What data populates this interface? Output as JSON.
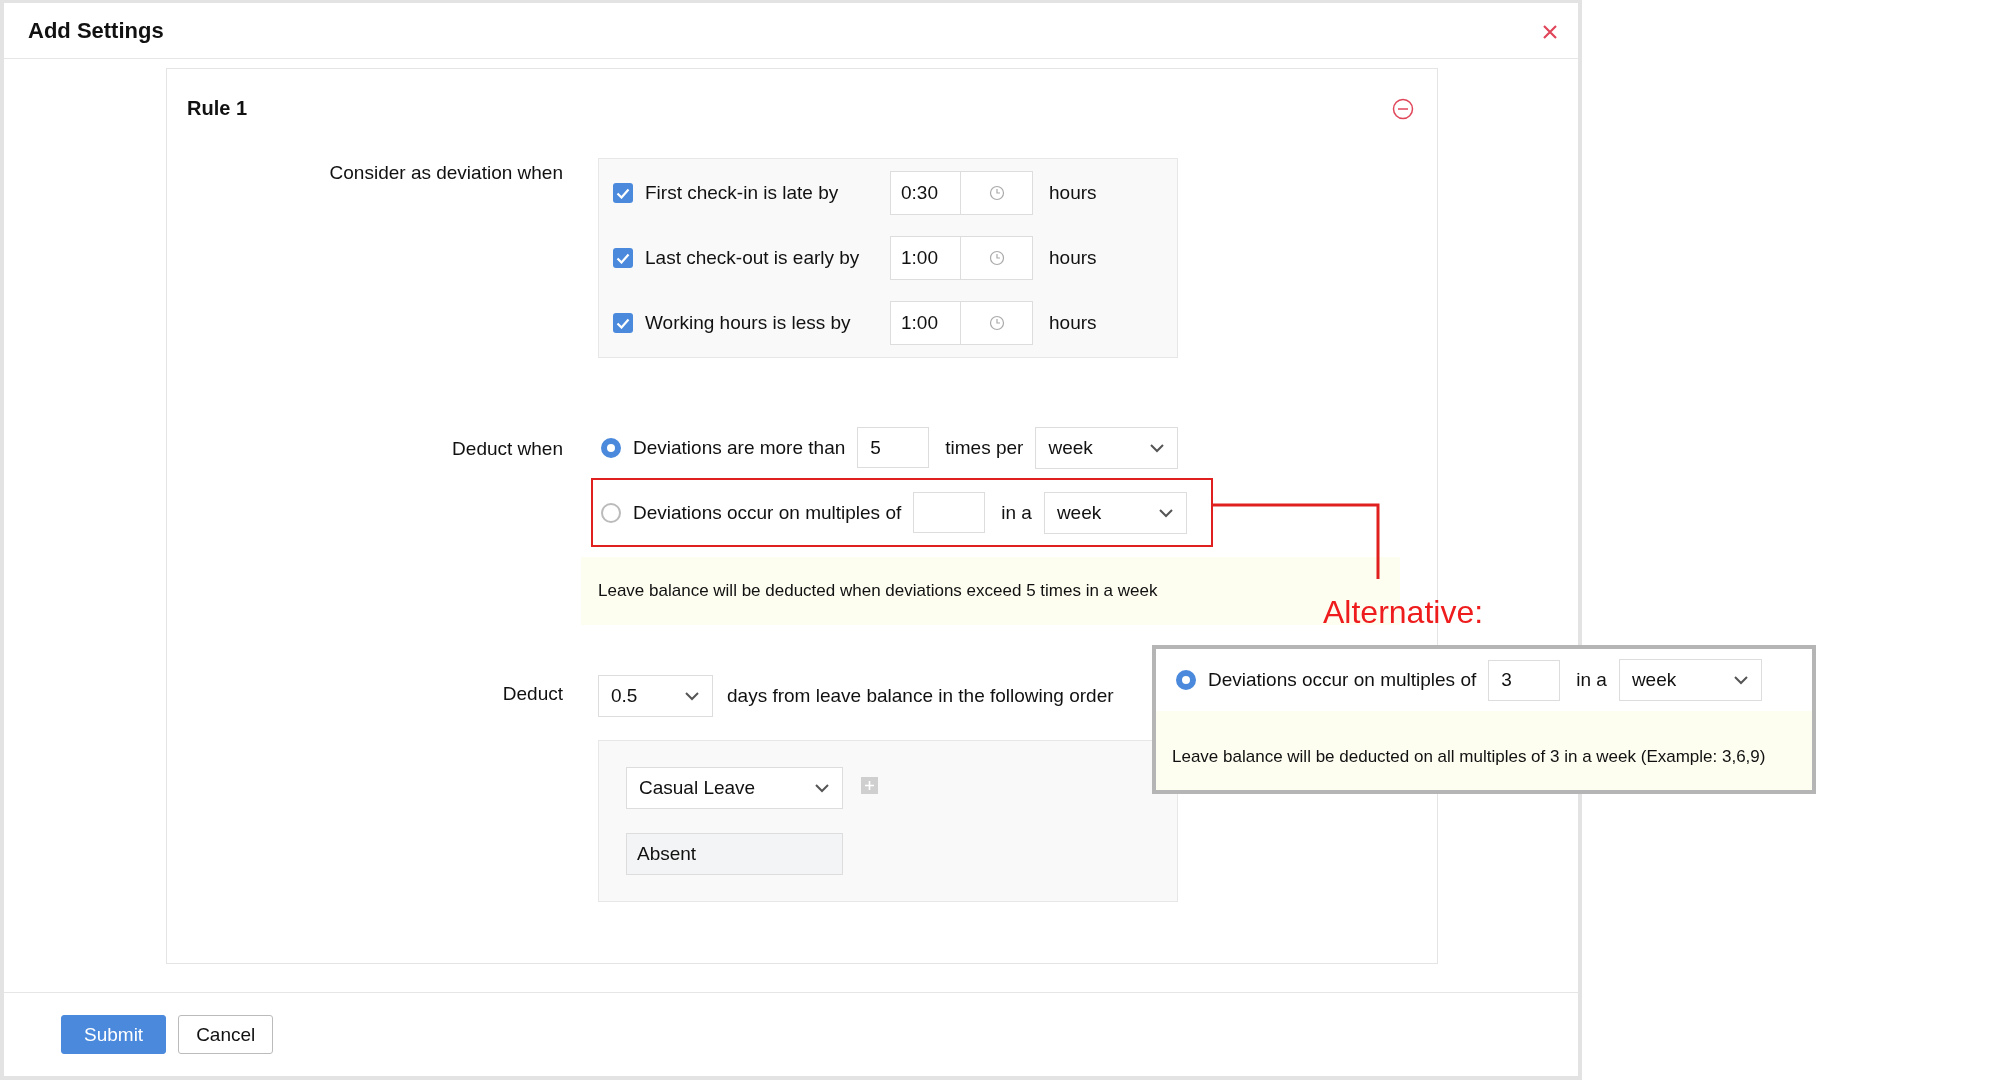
{
  "dialog": {
    "title": "Add Settings"
  },
  "rule": {
    "title": "Rule 1"
  },
  "deviation": {
    "label": "Consider as deviation when",
    "conditions": [
      {
        "label": "First check-in is late by",
        "checked": true,
        "value": "0:30",
        "unit": "hours"
      },
      {
        "label": "Last check-out is early by",
        "checked": true,
        "value": "1:00",
        "unit": "hours"
      },
      {
        "label": "Working hours is less by",
        "checked": true,
        "value": "1:00",
        "unit": "hours"
      }
    ]
  },
  "deduct_when": {
    "label": "Deduct when",
    "options": [
      {
        "text": "Deviations are more than",
        "selected": true,
        "highlighted": false,
        "value": "5",
        "connector": "times per",
        "period": "week"
      },
      {
        "text": "Deviations occur on multiples of",
        "selected": false,
        "highlighted": true,
        "connector": "in a",
        "period": "week"
      }
    ],
    "note": "Leave balance will be deducted when deviations exceed 5 times in a week"
  },
  "deduct": {
    "label": "Deduct",
    "amount": "0.5",
    "text": "days from leave balance in the following order",
    "leave_types": [
      {
        "kind": "select",
        "value": "Casual Leave"
      },
      {
        "kind": "field",
        "value": "Absent"
      }
    ]
  },
  "buttons": [
    {
      "label": "Submit",
      "kind": "primary"
    },
    {
      "label": "Cancel",
      "kind": "secondary"
    }
  ],
  "annotation": {
    "label": "Alternative:",
    "option": {
      "text": "Deviations occur on multiples of",
      "selected": true,
      "value": "3",
      "connector": "in a",
      "period": "week"
    },
    "note": "Leave balance will be deducted on all multiples of 3 in a week (Example: 3,6,9)"
  }
}
